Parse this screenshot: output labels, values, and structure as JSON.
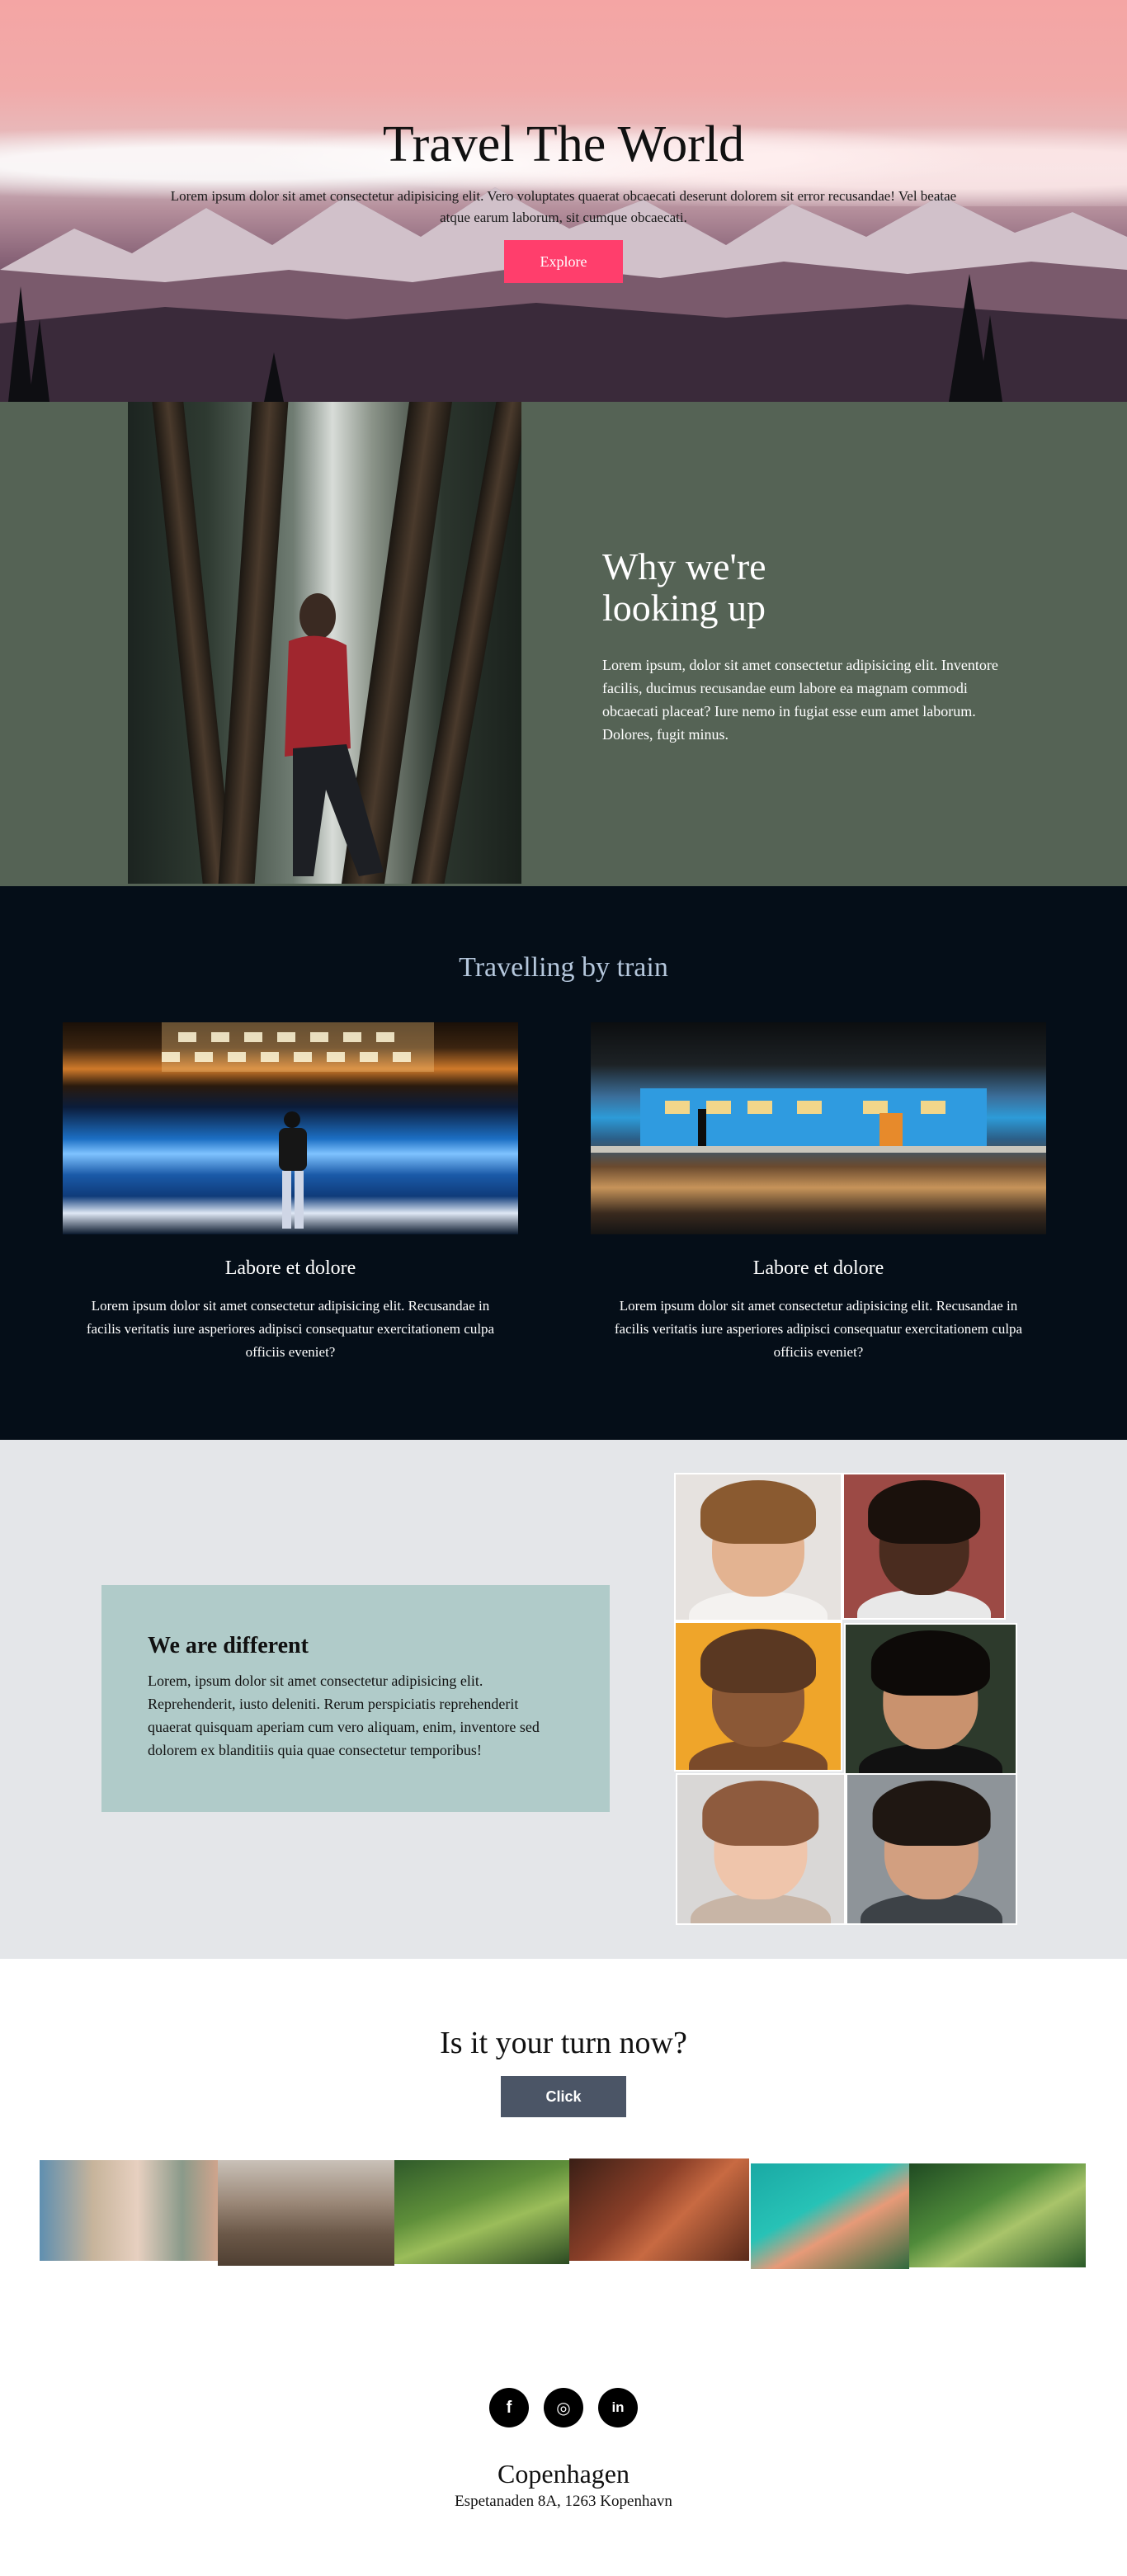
{
  "hero": {
    "title": "Travel The World",
    "text": "Lorem ipsum dolor sit amet consectetur adipisicing elit. Vero voluptates quaerat obcaecati deserunt dolorem sit error recusandae! Vel beatae atque earum laborum, sit cumque obcaecati.",
    "button_label": "Explore",
    "button_color": "#ff3e6c"
  },
  "why": {
    "title_line1": "Why we're",
    "title_line2": "looking up",
    "body": "Lorem ipsum, dolor sit amet consectetur adipisicing elit. Inventore facilis, ducimus recusandae eum labore ea magnam commodi obcaecati placeat? Iure nemo in fugiat esse eum amet laborum. Dolores, fugit minus.",
    "background": "#556355"
  },
  "train": {
    "title": "Travelling by train",
    "cards": [
      {
        "title": "Labore et dolore",
        "text": "Lorem ipsum dolor sit amet consectetur adipisicing elit. Recusandae in facilis veritatis iure asperiores adipisci consequatur exercitationem culpa officiis eveniet?"
      },
      {
        "title": "Labore et dolore",
        "text": "Lorem ipsum dolor sit amet consectetur adipisicing elit. Recusandae in facilis veritatis iure asperiores adipisci consequatur exercitationem culpa officiis eveniet?"
      }
    ]
  },
  "different": {
    "title": "We are different",
    "body": "Lorem, ipsum dolor sit amet consectetur adipisicing elit. Reprehenderit, iusto deleniti. Rerum perspiciatis reprehenderit quaerat quisquam aperiam cum vero aliquam, enim, inventore sed dolorem ex blanditiis quia quae consectetur temporibus!",
    "box_color": "#b0cbc9"
  },
  "cta": {
    "title": "Is it your turn now?",
    "button_label": "Click"
  },
  "footer": {
    "socials": [
      {
        "icon": "facebook-icon",
        "glyph": "f"
      },
      {
        "icon": "instagram-icon",
        "glyph": "◎"
      },
      {
        "icon": "linkedin-icon",
        "glyph": "in"
      }
    ],
    "city": "Copenhagen",
    "address": "Espetanaden 8A, 1263 Kopenhavn"
  }
}
